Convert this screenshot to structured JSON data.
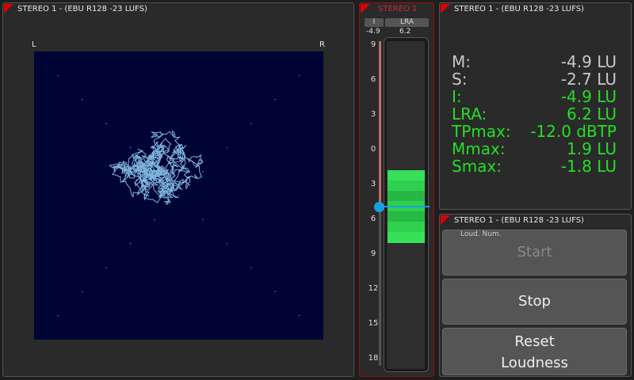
{
  "goniometer": {
    "title": "STEREO 1 - (EBU R128 -23 LUFS)",
    "left_label": "L",
    "right_label": "R"
  },
  "meter": {
    "title": "STEREO 1",
    "i_label": "I",
    "lra_label": "LRA",
    "i_value": "-4.9",
    "lra_value": "6.2",
    "scale": [
      "9",
      "6",
      "3",
      "0",
      "3",
      "6",
      "9",
      "12",
      "15",
      "18"
    ],
    "momentary_level": -4.9,
    "lra_range": [
      -1.8,
      -8.0
    ]
  },
  "stats": {
    "title": "STEREO 1 - (EBU R128 -23 LUFS)",
    "rows": [
      {
        "key": "M:",
        "value": "-4.9 LU",
        "color": "#c8c8c8"
      },
      {
        "key": "S:",
        "value": "-2.7 LU",
        "color": "#c8c8c8"
      },
      {
        "key": "I:",
        "value": "-4.9 LU",
        "color": "#22e022"
      },
      {
        "key": "LRA:",
        "value": "6.2 LU",
        "color": "#22e022"
      },
      {
        "key": "TPmax:",
        "value": "-12.0 dBTP",
        "color": "#22e022"
      },
      {
        "key": "Mmax:",
        "value": "1.9 LU",
        "color": "#22e022"
      },
      {
        "key": "Smax:",
        "value": "-1.8 LU",
        "color": "#22e022"
      }
    ]
  },
  "controls": {
    "title": "STEREO 1 - (EBU R128 -23 LUFS)",
    "subtitle": "Loud. Num.",
    "start_label": "Start",
    "stop_label": "Stop",
    "reset_label_1": "Reset",
    "reset_label_2": "Loudness"
  },
  "colors": {
    "accent_red": "#e00000",
    "green": "#22e022",
    "marker_blue": "#1aa0e0",
    "scope_bg": "#000434",
    "trace": "#8cc8f0"
  }
}
